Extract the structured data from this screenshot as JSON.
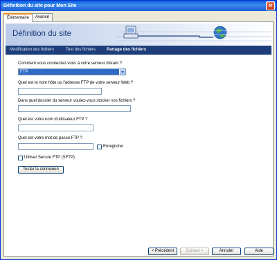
{
  "window": {
    "title": "Définition du site pour Mon Site"
  },
  "tabs": [
    {
      "label": "Élémentaire",
      "active": true
    },
    {
      "label": "Avancé",
      "active": false
    }
  ],
  "banner": {
    "title": "Définition du site"
  },
  "subnav": {
    "items": [
      "Modification des fichiers",
      "Test des fichiers",
      "Partage des fichiers"
    ],
    "current_index": 2
  },
  "form": {
    "q_connect": "Comment vous connectez-vous à votre serveur distant ?",
    "connect_value": "FTP",
    "q_host": "Quel est le nom hôte ou l'adresse FTP de votre serveur Web ?",
    "host_value": "",
    "q_folder": "Dans quel dossier du serveur voulez-vous stocker vos fichiers ?",
    "folder_value": "",
    "q_user": "Quel est votre nom d'utilisateur FTP ?",
    "user_value": "",
    "q_password": "Quel est votre mot de passe FTP ?",
    "password_value": "",
    "save_label": "Enregistrer",
    "sftp_label": "Utiliser Secure FTP (SFTP)",
    "test_button": "Tester la connexion"
  },
  "footer": {
    "prev": "< Précédent",
    "next": "Suivant >",
    "cancel": "Annuler",
    "help": "Aide"
  },
  "colors": {
    "titlebar": "#0a5fd8",
    "subnav": "#1d3e7a",
    "select_highlight": "#316ac5"
  }
}
